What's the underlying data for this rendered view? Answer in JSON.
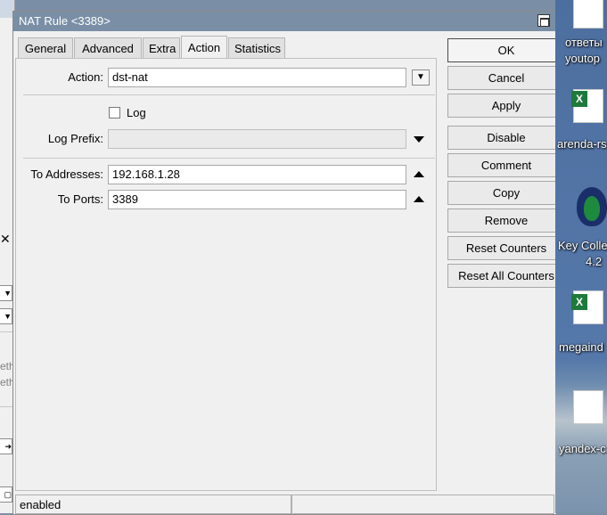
{
  "window": {
    "title": "NAT Rule <3389>"
  },
  "tabs": [
    {
      "label": "General"
    },
    {
      "label": "Advanced"
    },
    {
      "label": "Extra"
    },
    {
      "label": "Action"
    },
    {
      "label": "Statistics"
    }
  ],
  "form": {
    "action": {
      "label": "Action:",
      "value": "dst-nat"
    },
    "log": {
      "label": "Log",
      "checked": false
    },
    "log_prefix": {
      "label": "Log Prefix:",
      "value": ""
    },
    "to_addresses": {
      "label": "To Addresses:",
      "value": "192.168.1.28"
    },
    "to_ports": {
      "label": "To Ports:",
      "value": "3389"
    }
  },
  "buttons": {
    "ok": "OK",
    "cancel": "Cancel",
    "apply": "Apply",
    "disable": "Disable",
    "comment": "Comment",
    "copy": "Copy",
    "remove": "Remove",
    "reset_counters": "Reset Counters",
    "reset_all_counters": "Reset All Counters"
  },
  "status": {
    "state": "enabled",
    "second": ""
  },
  "background_window": {
    "fragment1": "eth",
    "fragment2": "eth"
  },
  "desktop": {
    "items": [
      {
        "label": "ответы",
        "label2": "youtop",
        "icon": "document-icon"
      },
      {
        "label": "arenda-rs",
        "icon": "excel-icon"
      },
      {
        "label": "Key Colle",
        "label2": "4.2",
        "icon": "keycollector-icon"
      },
      {
        "label": "megaind",
        "icon": "excel-icon"
      },
      {
        "label": "yandex-c",
        "icon": "document-icon"
      }
    ]
  },
  "colors": {
    "titlebar": "#7a8fa6",
    "window_bg": "#f0f0f0",
    "excel_green": "#1e7a3c"
  }
}
